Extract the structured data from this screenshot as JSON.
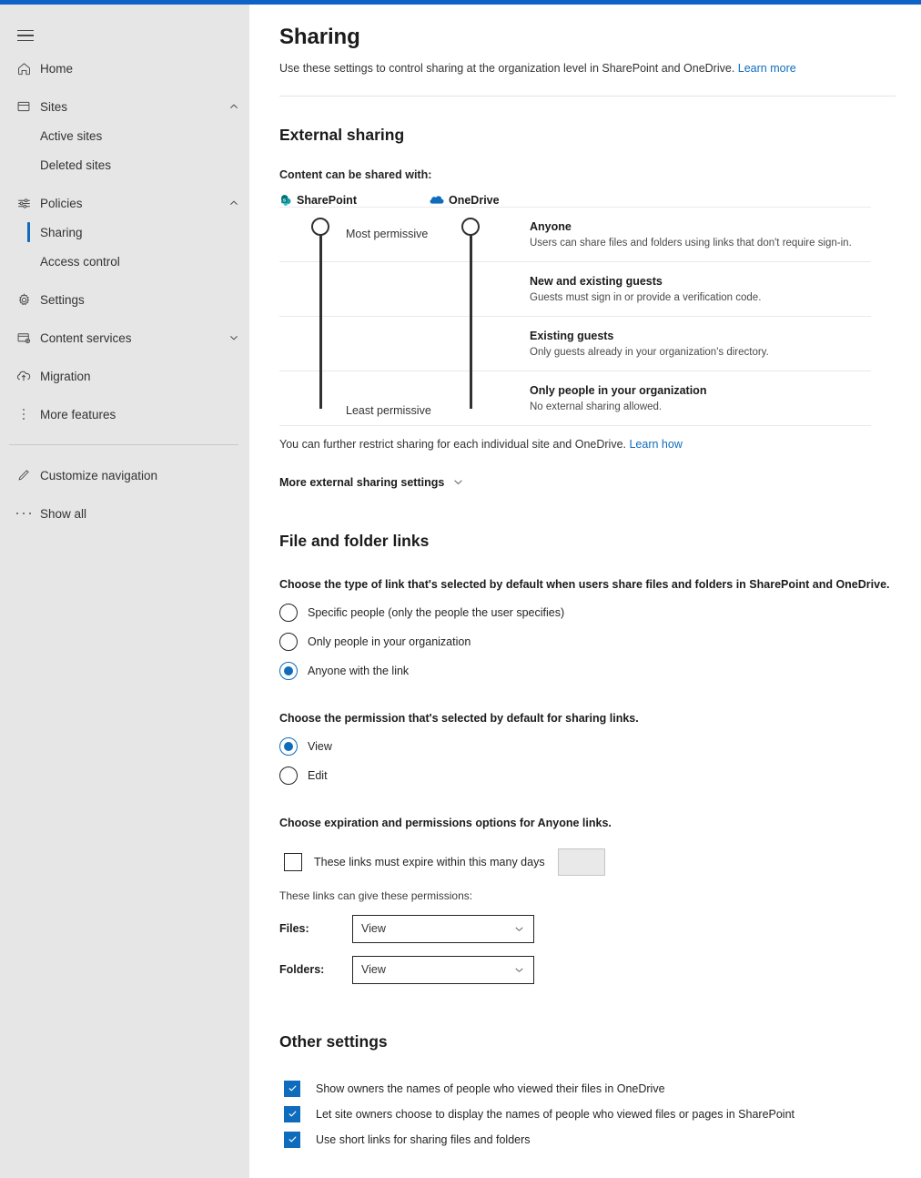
{
  "theme": {
    "accent": "#0f6cbd",
    "topbar": "#0f63c6",
    "sidebar_bg": "#e6e6e6",
    "slider_color": "#323130",
    "sharepoint_icon_color": "#038387",
    "onedrive_icon_color": "#0f6cbd"
  },
  "sidebar": {
    "menu_button": "menu-icon",
    "items": [
      {
        "label": "Home",
        "icon": "home-icon",
        "level": "top",
        "expandable": false
      },
      {
        "label": "Sites",
        "icon": "sites-icon",
        "level": "top",
        "expandable": true,
        "expanded": true
      },
      {
        "label": "Active sites",
        "icon": "",
        "level": "sub",
        "expandable": false
      },
      {
        "label": "Deleted sites",
        "icon": "",
        "level": "sub",
        "expandable": false
      },
      {
        "label": "Policies",
        "icon": "policies-icon",
        "level": "top",
        "expandable": true,
        "expanded": true
      },
      {
        "label": "Sharing",
        "icon": "",
        "level": "sub",
        "expandable": false,
        "selected": true
      },
      {
        "label": "Access control",
        "icon": "",
        "level": "sub",
        "expandable": false
      },
      {
        "label": "Settings",
        "icon": "gear-icon",
        "level": "top",
        "expandable": false
      },
      {
        "label": "Content services",
        "icon": "content-services-icon",
        "level": "top",
        "expandable": true,
        "expanded": false
      },
      {
        "label": "Migration",
        "icon": "migration-icon",
        "level": "top",
        "expandable": false
      },
      {
        "label": "More features",
        "icon": "more-features-icon",
        "level": "top",
        "expandable": false
      }
    ],
    "footer_items": [
      {
        "label": "Customize navigation",
        "icon": "pencil-icon"
      },
      {
        "label": "Show all",
        "icon": "ellipsis-icon"
      }
    ]
  },
  "header": {
    "title": "Sharing",
    "description": "Use these settings to control sharing at the organization level in SharePoint and OneDrive.",
    "learn_more": "Learn more"
  },
  "external_sharing": {
    "heading": "External sharing",
    "field_label": "Content can be shared with:",
    "services": [
      {
        "name": "SharePoint",
        "icon": "sharepoint-icon",
        "value": "Anyone"
      },
      {
        "name": "OneDrive",
        "icon": "onedrive-icon",
        "value": "Anyone"
      }
    ],
    "most_permissive_label": "Most permissive",
    "least_permissive_label": "Least permissive",
    "levels": [
      {
        "title": "Anyone",
        "description": "Users can share files and folders using links that don't require sign-in."
      },
      {
        "title": "New and existing guests",
        "description": "Guests must sign in or provide a verification code."
      },
      {
        "title": "Existing guests",
        "description": "Only guests already in your organization's directory."
      },
      {
        "title": "Only people in your organization",
        "description": "No external sharing allowed."
      }
    ],
    "restrict_note": "You can further restrict sharing for each individual site and OneDrive.",
    "restrict_link": "Learn how",
    "more_settings_label": "More external sharing settings",
    "more_settings_expanded": false
  },
  "file_folder_links": {
    "heading": "File and folder links",
    "link_type_prompt": "Choose the type of link that's selected by default when users share files and folders in SharePoint and OneDrive.",
    "link_type_options": [
      {
        "label": "Specific people (only the people the user specifies)",
        "selected": false
      },
      {
        "label": "Only people in your organization",
        "selected": false
      },
      {
        "label": "Anyone with the link",
        "selected": true
      }
    ],
    "permission_prompt": "Choose the permission that's selected by default for sharing links.",
    "permission_options": [
      {
        "label": "View",
        "selected": true
      },
      {
        "label": "Edit",
        "selected": false
      }
    ],
    "expiration_prompt": "Choose expiration and permissions options for Anyone links.",
    "expiration_checkbox_label": "These links must expire within this many days",
    "expiration_checked": false,
    "expiration_days_value": "",
    "expiration_days_placeholder": "",
    "permissions_note": "These links can give these permissions:",
    "permission_selects": [
      {
        "label": "Files:",
        "value": "View"
      },
      {
        "label": "Folders:",
        "value": "View"
      }
    ]
  },
  "other_settings": {
    "heading": "Other settings",
    "checkboxes": [
      {
        "label": "Show owners the names of people who viewed their files in OneDrive",
        "checked": true
      },
      {
        "label": "Let site owners choose to display the names of people who viewed files or pages in SharePoint",
        "checked": true
      },
      {
        "label": "Use short links for sharing files and folders",
        "checked": true
      }
    ]
  }
}
